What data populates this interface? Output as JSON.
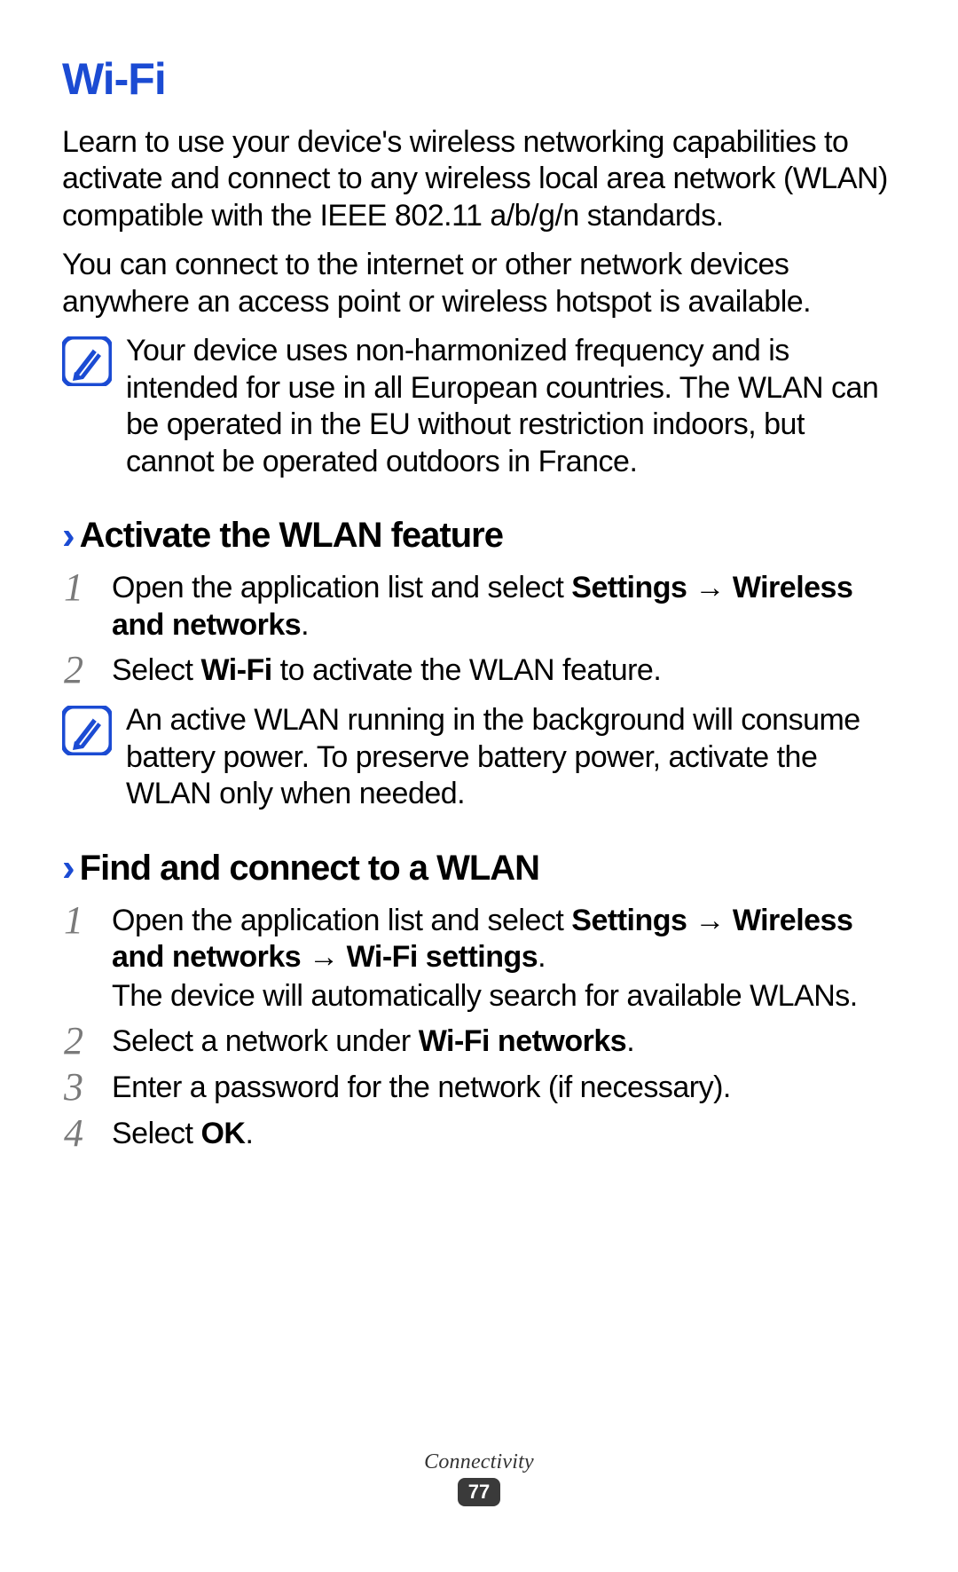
{
  "title": "Wi-Fi",
  "intro": {
    "p1": "Learn to use your device's wireless networking capabilities to activate and connect to any wireless local area network (WLAN) compatible with the IEEE 802.11 a/b/g/n standards.",
    "p2": "You can connect to the internet or other network devices anywhere an access point or wireless hotspot is available."
  },
  "note1": "Your device uses non-harmonized frequency and is intended for use in all European countries. The WLAN can be operated in the EU without restriction indoors, but cannot be operated outdoors in France.",
  "section1": {
    "heading": "Activate the WLAN feature",
    "step1_pre": "Open the application list and select ",
    "step1_b1": "Settings",
    "step1_arrow": " → ",
    "step1_b2": "Wireless and networks",
    "step1_post": ".",
    "step2_pre": "Select ",
    "step2_b1": "Wi-Fi",
    "step2_post": " to activate the WLAN feature.",
    "note": "An active WLAN running in the background will consume battery power. To preserve battery power, activate the WLAN only when needed."
  },
  "section2": {
    "heading": "Find and connect to a WLAN",
    "step1_pre": "Open the application list and select ",
    "step1_b1": "Settings",
    "step1_arrow1": " → ",
    "step1_b2": "Wireless and networks",
    "step1_arrow2": " → ",
    "step1_b3": "Wi-Fi settings",
    "step1_post": ".",
    "step1_sub": "The device will automatically search for available WLANs.",
    "step2_pre": "Select a network under ",
    "step2_b1": "Wi-Fi networks",
    "step2_post": ".",
    "step3": "Enter a password for the network (if necessary).",
    "step4_pre": "Select ",
    "step4_b1": "OK",
    "step4_post": "."
  },
  "nums": {
    "n1": "1",
    "n2": "2",
    "n3": "3",
    "n4": "4"
  },
  "footer": {
    "section": "Connectivity",
    "page": "77"
  }
}
